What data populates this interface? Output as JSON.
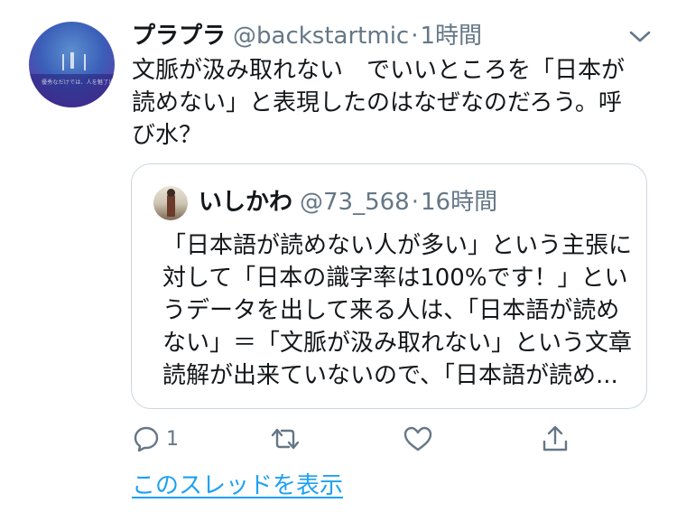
{
  "tweet": {
    "display_name": "プラプラ",
    "handle": "@backstartmic",
    "separator": "·",
    "time": "1時間",
    "avatar_caption": "優秀なだけでは、人を魅了出来ない。",
    "text_lines": [
      "文脈が汲み取れない　でいいところを「日本が",
      "読めない」と表現したのはなぜなのだろう。呼",
      "び水？"
    ]
  },
  "quoted": {
    "display_name": "いしかわ",
    "handle": "@73_568",
    "separator": "·",
    "time": "16時間",
    "text_lines": [
      "「日本語が読めない人が多い」という主張に",
      "対して「日本の識字率は100%です！」とい",
      "うデータを出して来る人は、「日本語が読め",
      "ない」＝「文脈が汲み取れない」という文章",
      "読解が出来ていないので、「日本語が読め..."
    ]
  },
  "actions": {
    "reply_count": "1"
  },
  "thread_link": "このスレッドを表示",
  "colors": {
    "text": "#14171a",
    "secondary": "#657786",
    "accent": "#1da1f2",
    "border": "#ccd6dd"
  },
  "icons": [
    "reply-icon",
    "retweet-icon",
    "like-icon",
    "share-icon",
    "chevron-down-icon"
  ]
}
